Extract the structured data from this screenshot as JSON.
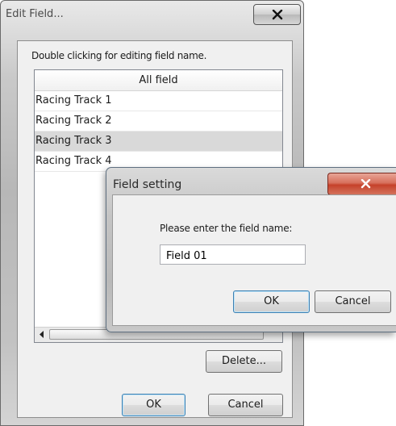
{
  "edit_window": {
    "title": "Edit Field...",
    "hint": "Double clicking for editing field name.",
    "list_header": "All field",
    "rows": [
      "Racing Track 1",
      "Racing Track 2",
      "Racing Track 3",
      "Racing Track 4"
    ],
    "selected_row": "Racing Track 3",
    "delete_label": "Delete...",
    "ok_label": "OK",
    "cancel_label": "Cancel"
  },
  "field_dialog": {
    "title": "Field setting",
    "prompt": "Please enter the field name:",
    "field_value": "Field 01",
    "ok_label": "OK",
    "cancel_label": "Cancel"
  },
  "colors": {
    "selection": "#d9d9d9",
    "close_button_active": "#c5412a",
    "default_button_border": "#3c7fb1"
  }
}
